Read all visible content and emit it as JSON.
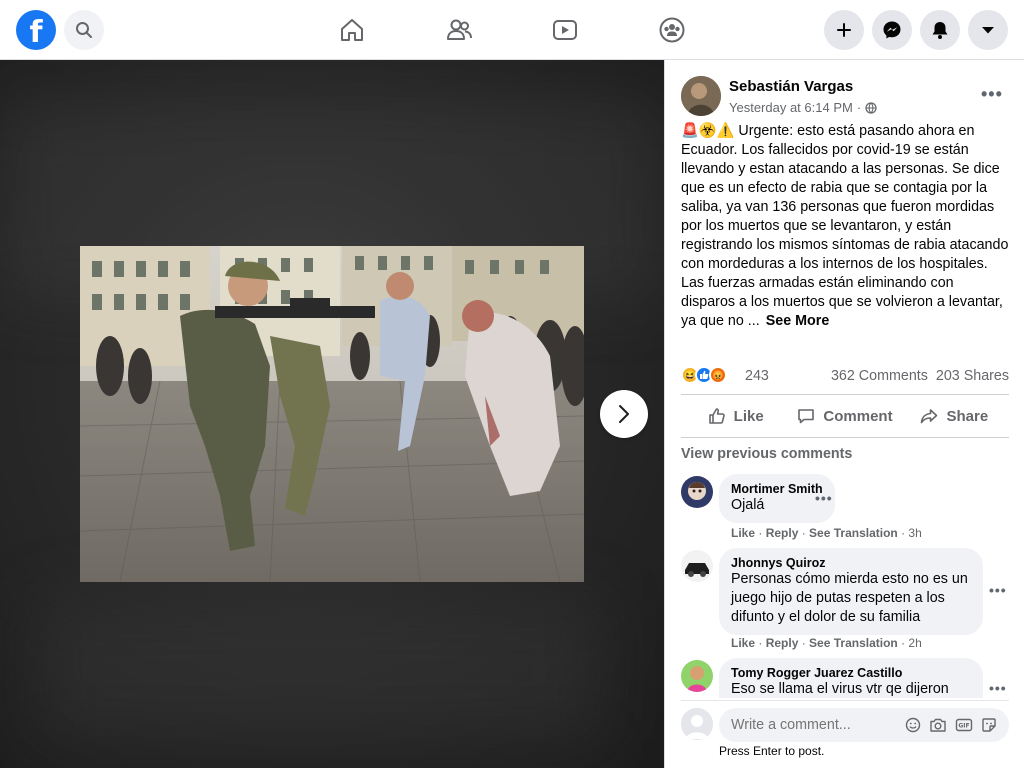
{
  "topbar": {
    "logo": "f",
    "icons": [
      "facebook-logo",
      "search-icon",
      "home-icon",
      "friends-icon",
      "watch-icon",
      "groups-icon",
      "plus-icon",
      "messenger-icon",
      "notifications-icon",
      "account-menu-icon"
    ],
    "accent": "#1877f2"
  },
  "post": {
    "author": "Sebastián Vargas",
    "timestamp": "Yesterday at 6:14 PM",
    "separator": "·",
    "text": "🚨☣️⚠️ Urgente: esto está pasando ahora en Ecuador. Los fallecidos por covid-19 se están llevando y estan atacando a las personas. Se dice que es un efecto de rabia que se contagia por la saliba, ya van 136 personas que fueron mordidas por los muertos que se levantaron, y están registrando los mismos síntomas de rabia atacando con mordeduras a los internos de los hospitales. Las fuerzas armadas están eliminando con disparos a los muertos que se volvieron a levantar, ya que no ...",
    "see_more": "See More",
    "reaction_count": "243",
    "comments_count": "362 Comments",
    "shares_count": "203 Shares",
    "actions": {
      "like": "Like",
      "comment": "Comment",
      "share": "Share"
    },
    "view_previous": "View previous comments"
  },
  "comments": [
    {
      "name": "Mortimer Smith",
      "text": "Ojalá",
      "like": "Like",
      "reply": "Reply",
      "translation": "See Translation",
      "time": "3h"
    },
    {
      "name": "Jhonnys Quiroz",
      "text": "Personas cómo mierda esto no es un juego hijo de putas respeten a los difunto y el dolor de su familia",
      "like": "Like",
      "reply": "Reply",
      "translation": "See Translation",
      "time": "2h"
    },
    {
      "name": "Tomy Rogger Juarez Castillo",
      "text": "Eso se llama el virus vtr qe dijeron"
    }
  ],
  "composer": {
    "placeholder": "Write a comment...",
    "hint": "Press Enter to post."
  }
}
